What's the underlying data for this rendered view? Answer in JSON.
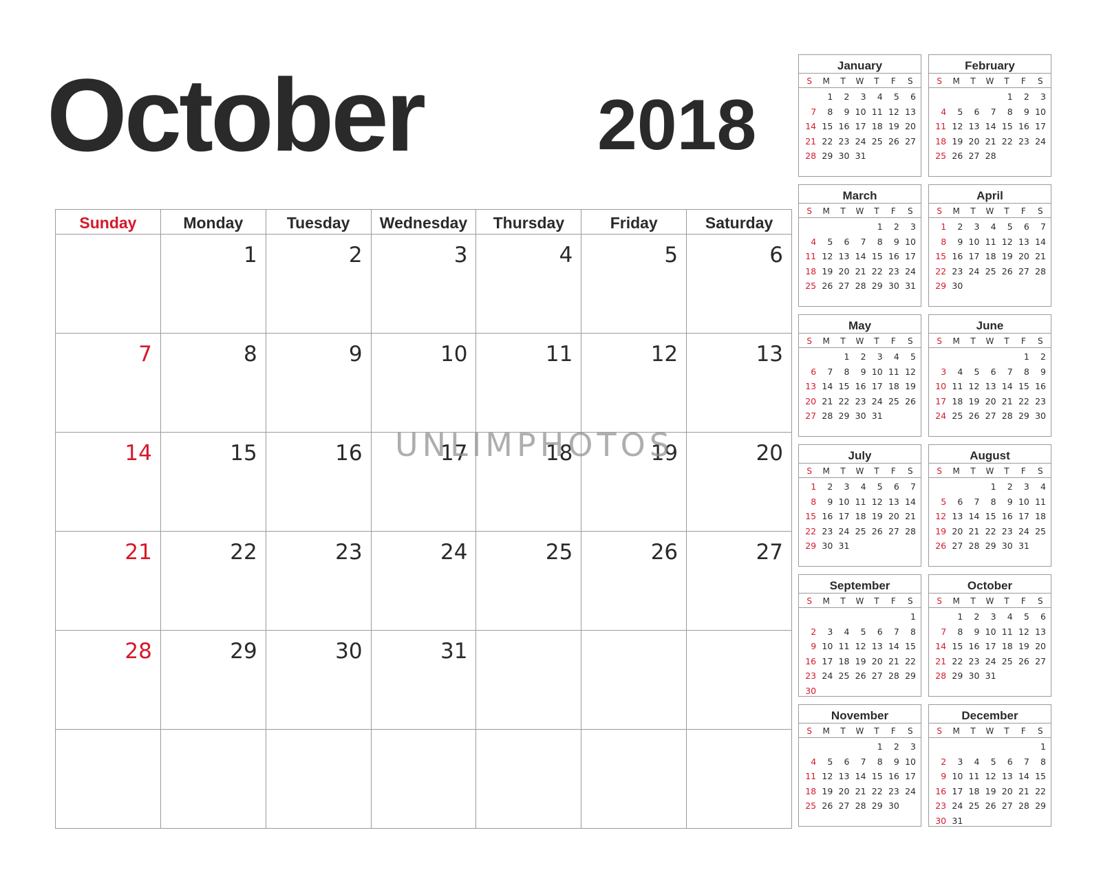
{
  "title": {
    "month": "October",
    "year": "2018"
  },
  "colors": {
    "text": "#2a2a2a",
    "sunday": "#d6182a",
    "grid": "#9a9a9a"
  },
  "weekdays": [
    "Sunday",
    "Monday",
    "Tuesday",
    "Wednesday",
    "Thursday",
    "Friday",
    "Saturday"
  ],
  "main_weeks": [
    [
      "",
      "1",
      "2",
      "3",
      "4",
      "5",
      "6"
    ],
    [
      "7",
      "8",
      "9",
      "10",
      "11",
      "12",
      "13"
    ],
    [
      "14",
      "15",
      "16",
      "17",
      "18",
      "19",
      "20"
    ],
    [
      "21",
      "22",
      "23",
      "24",
      "25",
      "26",
      "27"
    ],
    [
      "28",
      "29",
      "30",
      "31",
      "",
      "",
      ""
    ],
    [
      "",
      "",
      "",
      "",
      "",
      "",
      ""
    ]
  ],
  "mini_dow": [
    "S",
    "M",
    "T",
    "W",
    "T",
    "F",
    "S"
  ],
  "mini_months": [
    {
      "name": "January",
      "start": 1,
      "days": 31
    },
    {
      "name": "February",
      "start": 4,
      "days": 28
    },
    {
      "name": "March",
      "start": 4,
      "days": 31
    },
    {
      "name": "April",
      "start": 0,
      "days": 30
    },
    {
      "name": "May",
      "start": 2,
      "days": 31
    },
    {
      "name": "June",
      "start": 5,
      "days": 30
    },
    {
      "name": "July",
      "start": 0,
      "days": 31
    },
    {
      "name": "August",
      "start": 3,
      "days": 31
    },
    {
      "name": "September",
      "start": 6,
      "days": 30
    },
    {
      "name": "October",
      "start": 1,
      "days": 31
    },
    {
      "name": "November",
      "start": 4,
      "days": 30
    },
    {
      "name": "December",
      "start": 6,
      "days": 31
    }
  ],
  "watermark": "UNLIMPHOTOS"
}
